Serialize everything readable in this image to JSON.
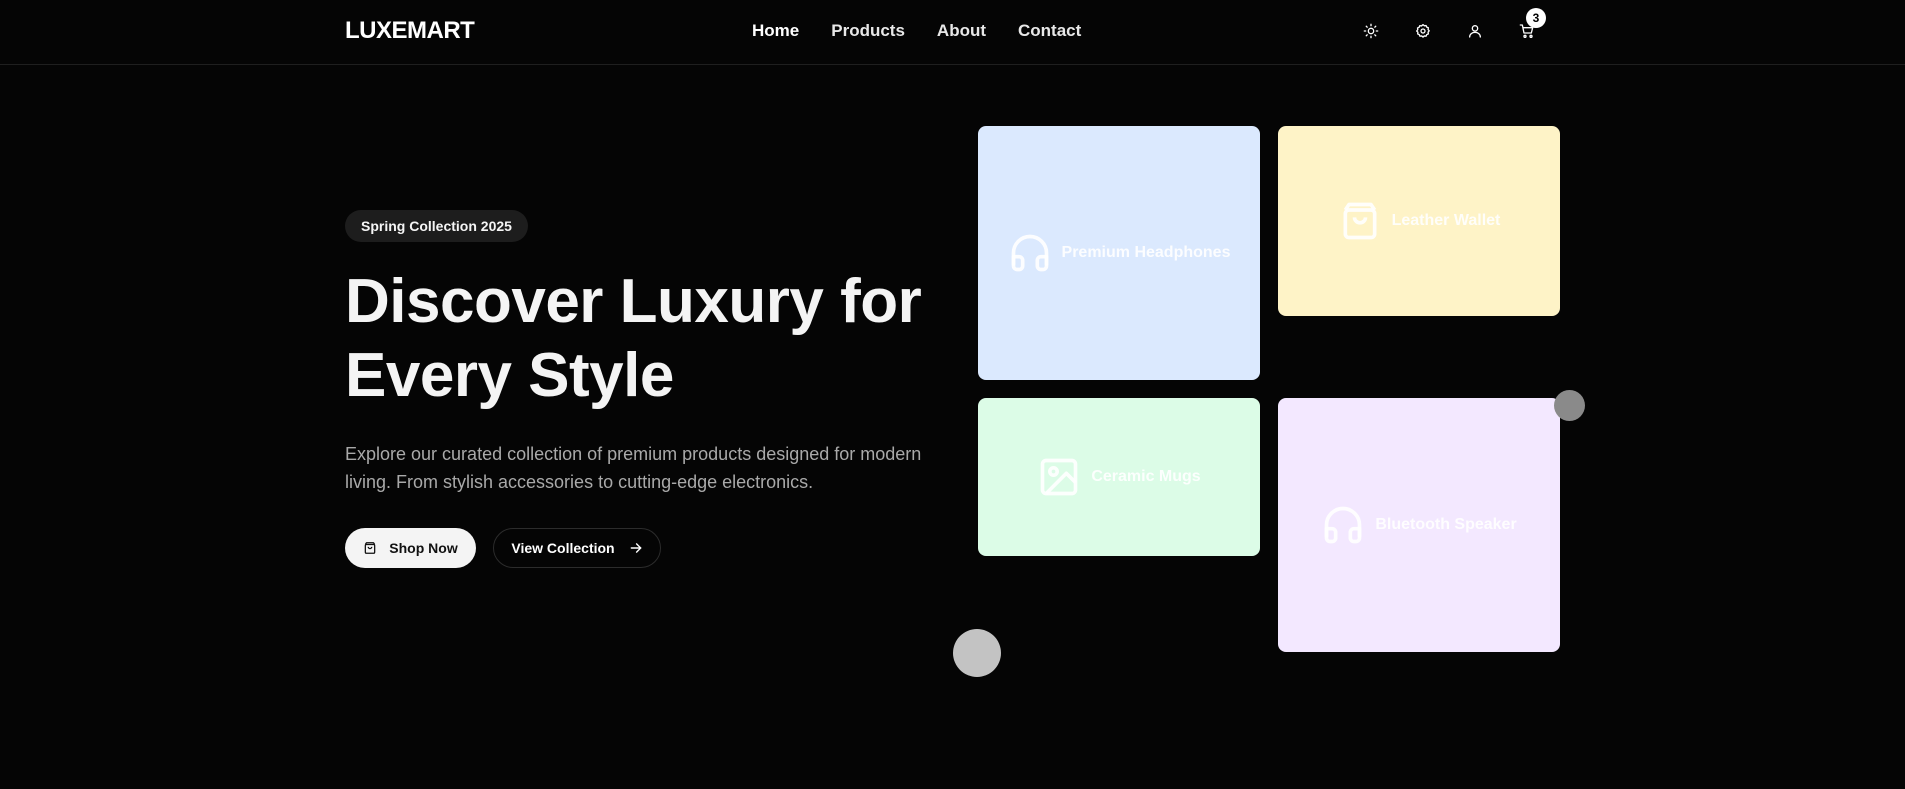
{
  "header": {
    "logo": "LUXEMART",
    "nav": [
      {
        "label": "Home"
      },
      {
        "label": "Products"
      },
      {
        "label": "About"
      },
      {
        "label": "Contact"
      }
    ],
    "icons": [
      "sun-icon",
      "gear-icon",
      "user-icon",
      "cart-icon"
    ],
    "cart_count": "3"
  },
  "hero": {
    "badge": "Spring Collection 2025",
    "title_line1": "Discover Luxury for",
    "title_line2": "Every Style",
    "description": "Explore our curated collection of premium products designed for modern living. From stylish accessories to cutting-edge electronics.",
    "primary_button": "Shop Now",
    "secondary_button": "View Collection"
  },
  "cards": [
    {
      "label": "Premium Headphones",
      "icon": "headphones-icon",
      "color": "#dbe9fe"
    },
    {
      "label": "Leather Wallet",
      "icon": "shopping-bag-icon",
      "color": "#fef3c7"
    },
    {
      "label": "Ceramic Mugs",
      "icon": "image-icon",
      "color": "#dcfce7"
    },
    {
      "label": "Bluetooth Speaker",
      "icon": "headphones-icon",
      "color": "#f3e8ff"
    }
  ],
  "colors": {
    "background": "#050505",
    "text": "#f4f4f4",
    "muted": "#a9a9a9"
  }
}
